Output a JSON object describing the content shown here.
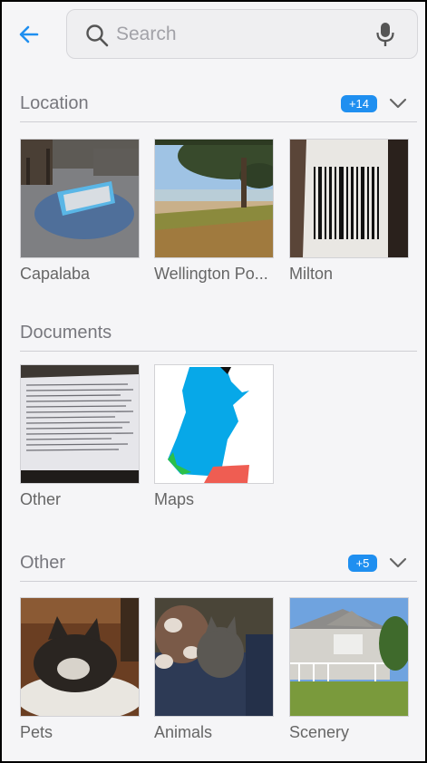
{
  "search": {
    "placeholder": "Search"
  },
  "icons": {
    "back": "back-arrow-icon",
    "search": "search-icon",
    "mic": "microphone-icon",
    "expand": "chevron-down-icon"
  },
  "colors": {
    "accent": "#1f8ff0",
    "section_title": "#77777d",
    "caption": "#666666",
    "background": "#f5f5f7"
  },
  "sections": {
    "location": {
      "title": "Location",
      "badge": "+14",
      "items": [
        {
          "label": "Capalaba"
        },
        {
          "label": "Wellington Po..."
        },
        {
          "label": "Milton"
        }
      ]
    },
    "documents": {
      "title": "Documents",
      "items": [
        {
          "label": "Other"
        },
        {
          "label": "Maps"
        }
      ]
    },
    "other": {
      "title": "Other",
      "badge": "+5",
      "items": [
        {
          "label": "Pets"
        },
        {
          "label": "Animals"
        },
        {
          "label": "Scenery"
        }
      ]
    }
  }
}
